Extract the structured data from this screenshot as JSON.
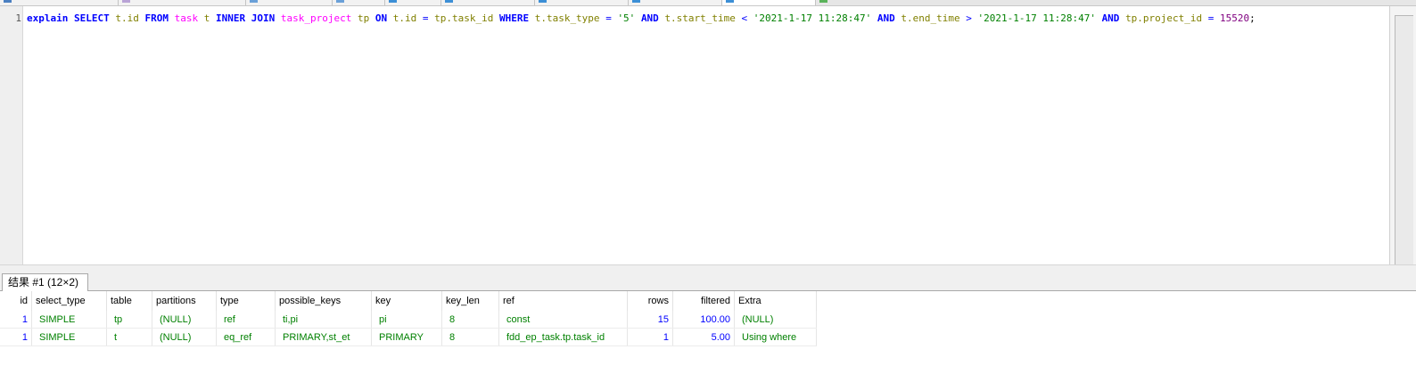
{
  "query": {
    "line_number": "1",
    "tokens": [
      {
        "t": "explain",
        "c": "kw"
      },
      {
        "t": " ",
        "c": ""
      },
      {
        "t": "SELECT",
        "c": "kw"
      },
      {
        "t": " ",
        "c": ""
      },
      {
        "t": "t.id",
        "c": "fld"
      },
      {
        "t": " ",
        "c": ""
      },
      {
        "t": "FROM",
        "c": "kw"
      },
      {
        "t": " ",
        "c": ""
      },
      {
        "t": "task",
        "c": "tbl"
      },
      {
        "t": " ",
        "c": ""
      },
      {
        "t": "t",
        "c": "fld"
      },
      {
        "t": " ",
        "c": ""
      },
      {
        "t": "INNER",
        "c": "kw"
      },
      {
        "t": " ",
        "c": ""
      },
      {
        "t": "JOIN",
        "c": "kw"
      },
      {
        "t": " ",
        "c": ""
      },
      {
        "t": "task_project",
        "c": "tbl"
      },
      {
        "t": " ",
        "c": ""
      },
      {
        "t": "tp",
        "c": "fld"
      },
      {
        "t": " ",
        "c": ""
      },
      {
        "t": "ON",
        "c": "kw"
      },
      {
        "t": " ",
        "c": ""
      },
      {
        "t": "t.id",
        "c": "fld"
      },
      {
        "t": " ",
        "c": ""
      },
      {
        "t": "=",
        "c": "op"
      },
      {
        "t": " ",
        "c": ""
      },
      {
        "t": "tp.task_id",
        "c": "fld"
      },
      {
        "t": " ",
        "c": ""
      },
      {
        "t": "WHERE",
        "c": "kw"
      },
      {
        "t": " ",
        "c": ""
      },
      {
        "t": "t.task_type",
        "c": "fld"
      },
      {
        "t": " ",
        "c": ""
      },
      {
        "t": "=",
        "c": "op"
      },
      {
        "t": " ",
        "c": ""
      },
      {
        "t": "'5'",
        "c": "str"
      },
      {
        "t": " ",
        "c": ""
      },
      {
        "t": "AND",
        "c": "kw"
      },
      {
        "t": " ",
        "c": ""
      },
      {
        "t": "t.start_time",
        "c": "fld"
      },
      {
        "t": " ",
        "c": ""
      },
      {
        "t": "<",
        "c": "op"
      },
      {
        "t": " ",
        "c": ""
      },
      {
        "t": "'2021-1-17 11:28:47'",
        "c": "str"
      },
      {
        "t": " ",
        "c": ""
      },
      {
        "t": "AND",
        "c": "kw"
      },
      {
        "t": " ",
        "c": ""
      },
      {
        "t": "t.end_time",
        "c": "fld"
      },
      {
        "t": " ",
        "c": ""
      },
      {
        "t": ">",
        "c": "op"
      },
      {
        "t": " ",
        "c": ""
      },
      {
        "t": "'2021-1-17 11:28:47'",
        "c": "str"
      },
      {
        "t": " ",
        "c": ""
      },
      {
        "t": "AND",
        "c": "kw"
      },
      {
        "t": " ",
        "c": ""
      },
      {
        "t": "tp.project_id",
        "c": "fld"
      },
      {
        "t": " ",
        "c": ""
      },
      {
        "t": "=",
        "c": "op"
      },
      {
        "t": " ",
        "c": ""
      },
      {
        "t": "15520",
        "c": "num"
      },
      {
        "t": ";",
        "c": ""
      }
    ]
  },
  "result_tab": {
    "label": "结果 #1 (12×2)"
  },
  "grid": {
    "columns": [
      {
        "label": "id",
        "align": "right"
      },
      {
        "label": "select_type",
        "align": "left"
      },
      {
        "label": "table",
        "align": "left"
      },
      {
        "label": "partitions",
        "align": "left"
      },
      {
        "label": "type",
        "align": "left"
      },
      {
        "label": "possible_keys",
        "align": "left"
      },
      {
        "label": "key",
        "align": "left"
      },
      {
        "label": "key_len",
        "align": "left"
      },
      {
        "label": "ref",
        "align": "left"
      },
      {
        "label": "rows",
        "align": "right"
      },
      {
        "label": "filtered",
        "align": "right"
      },
      {
        "label": "Extra",
        "align": "left"
      }
    ],
    "rows": [
      [
        "1",
        "SIMPLE",
        "tp",
        "(NULL)",
        "ref",
        "ti,pi",
        "pi",
        "8",
        "const",
        "15",
        "100.00",
        "(NULL)"
      ],
      [
        "1",
        "SIMPLE",
        "t",
        "(NULL)",
        "eq_ref",
        "PRIMARY,st_et",
        "PRIMARY",
        "8",
        "fdd_ep_task.tp.task_id",
        "1",
        "5.00",
        "Using where"
      ]
    ]
  },
  "colors": {
    "keyword": "#0000ff",
    "table_name": "#ff00ff",
    "field": "#808000",
    "string": "#008000",
    "number": "#800080",
    "grid_text": "#008000",
    "grid_numeric": "#0000ff"
  }
}
